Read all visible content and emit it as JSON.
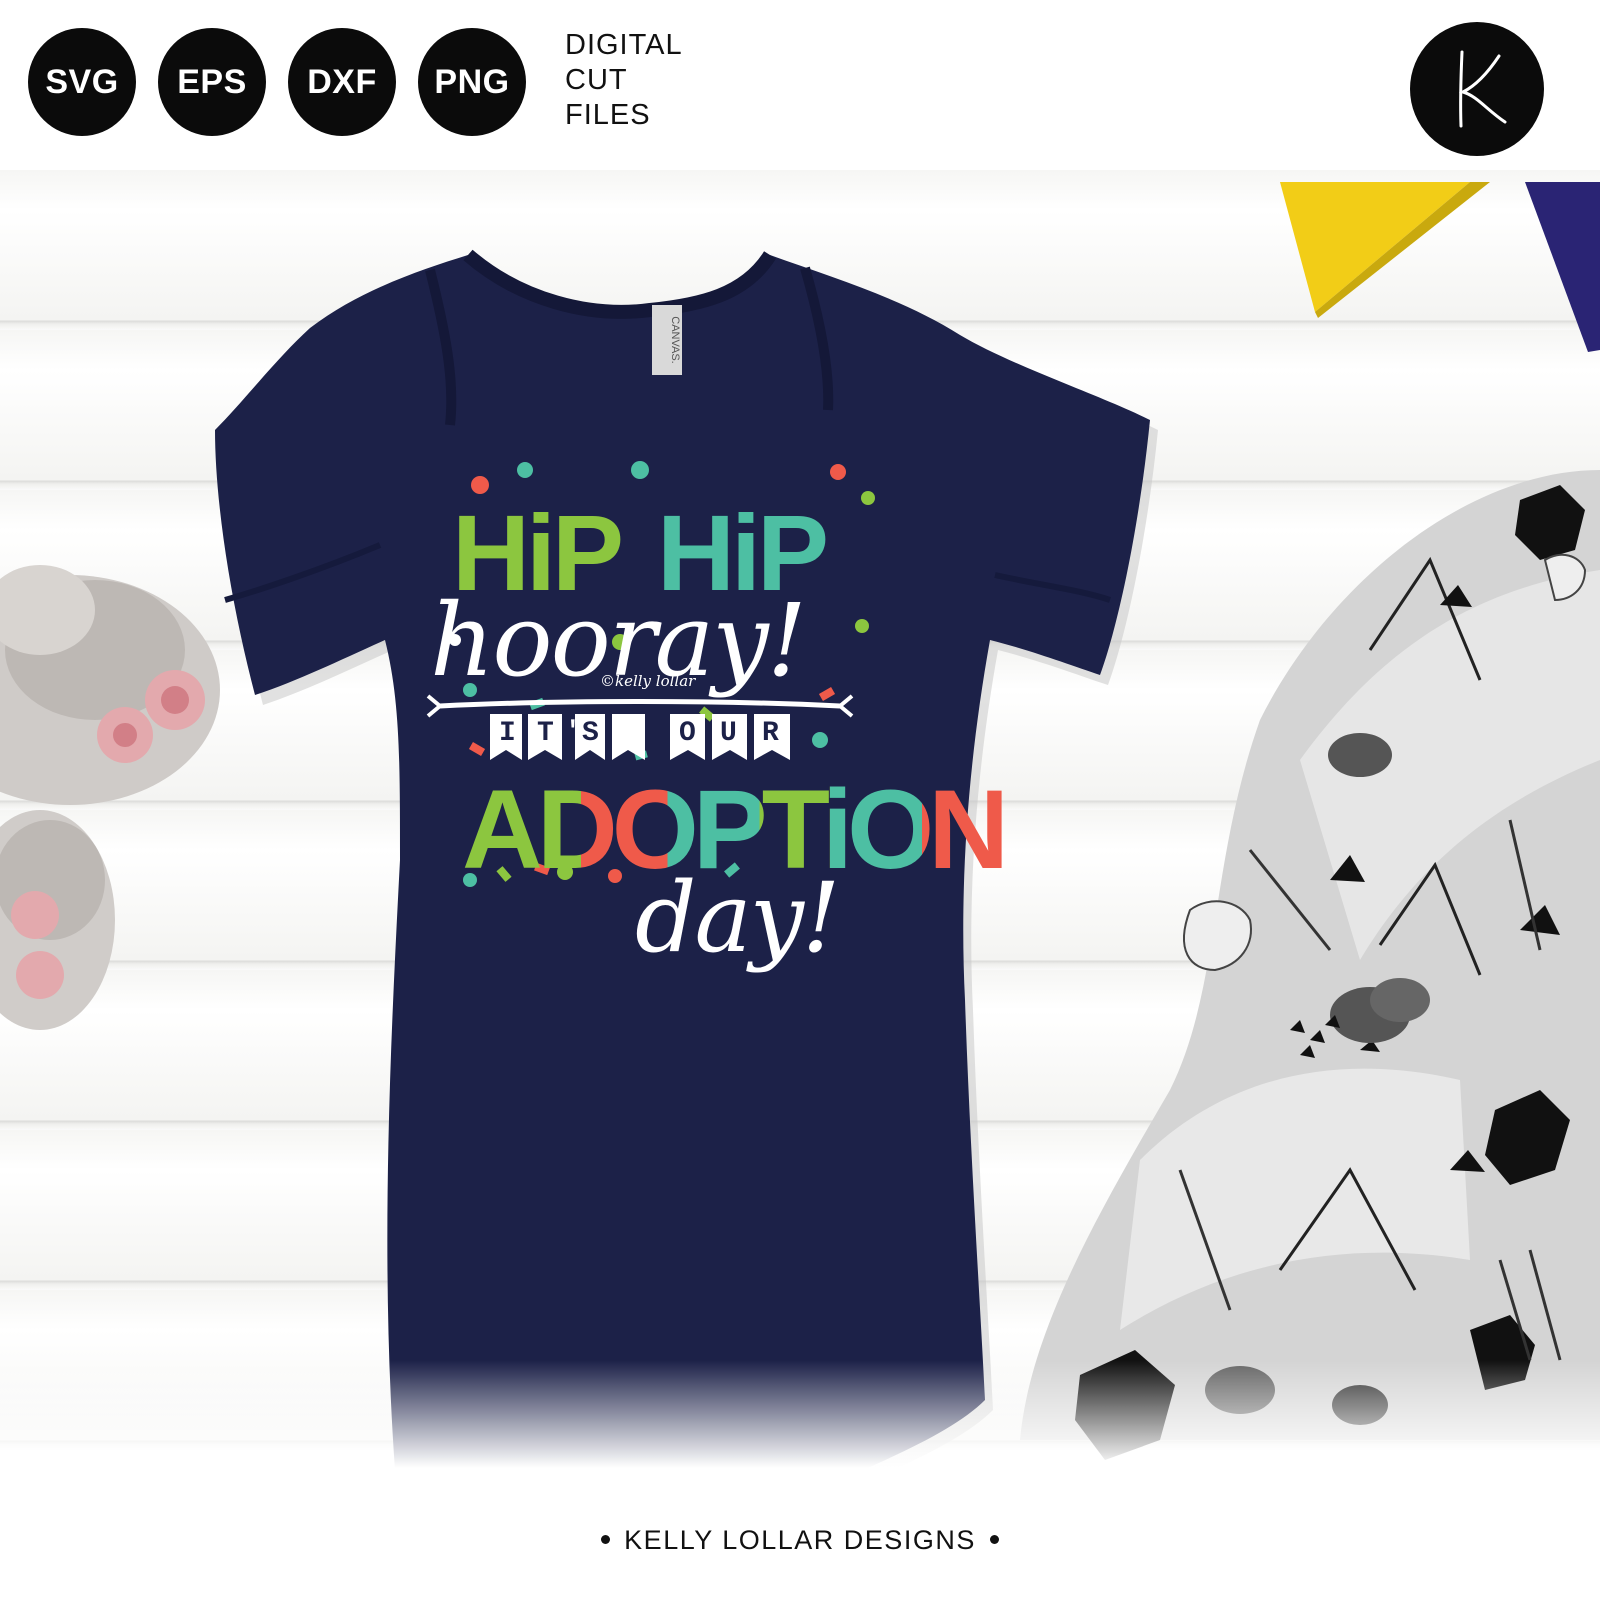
{
  "formats": [
    "SVG",
    "EPS",
    "DXF",
    "PNG"
  ],
  "cut_files_label": [
    "DIGITAL",
    "CUT",
    "FILES"
  ],
  "logo_letter": "K",
  "brand": "KELLY LOLLAR DESIGNS",
  "label_tag_text": "CANVAS.",
  "design": {
    "line1_a": "HiP",
    "line1_b": "HiP",
    "line2": "hooray!",
    "copyright": "©kelly lollar",
    "banner_letters": [
      "I",
      "T",
      "'",
      "S",
      "O",
      "U",
      "R"
    ],
    "line4": "ADOPTiON",
    "line5": "day!"
  },
  "colors": {
    "onesie": "#1c2148",
    "green": "#8cc63f",
    "teal": "#4dbfa3",
    "coral": "#ef5a4a",
    "white": "#ffffff",
    "pennant_yellow": "#f2cd17",
    "pennant_navy": "#2a2474"
  }
}
